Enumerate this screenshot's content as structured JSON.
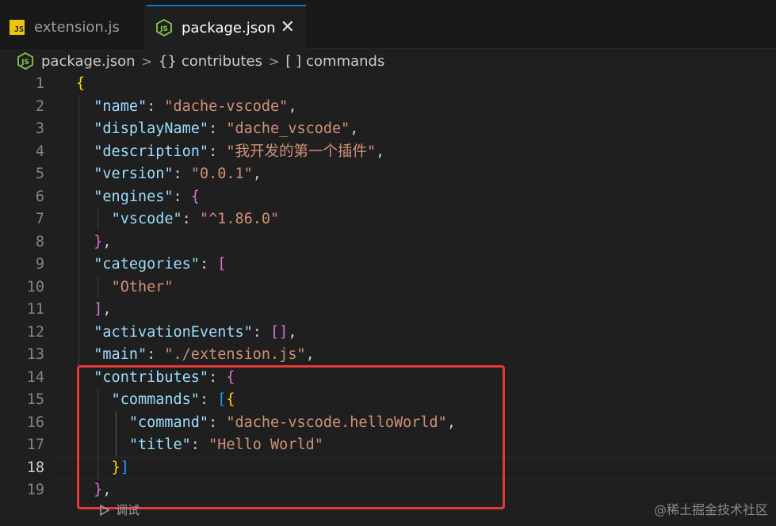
{
  "tabs": [
    {
      "label": "extension.js",
      "icon": "js-file-icon",
      "active": false
    },
    {
      "label": "package.json",
      "icon": "nodejs-file-icon",
      "active": true,
      "close": "✕"
    }
  ],
  "breadcrumb": {
    "file": "package.json",
    "sep": ">",
    "item1_sym": "{}",
    "item1": "contributes",
    "item2_sym": "[ ]",
    "item2": "commands"
  },
  "lines": [
    {
      "n": "1",
      "parts": [
        [
          "b1",
          "{"
        ]
      ]
    },
    {
      "n": "2",
      "parts": [
        [
          "p",
          "  "
        ],
        [
          "k",
          "\"name\""
        ],
        [
          "p",
          ": "
        ],
        [
          "s",
          "\"dache-vscode\""
        ],
        [
          "p",
          ","
        ]
      ]
    },
    {
      "n": "3",
      "parts": [
        [
          "p",
          "  "
        ],
        [
          "k",
          "\"displayName\""
        ],
        [
          "p",
          ": "
        ],
        [
          "s",
          "\"dache_vscode\""
        ],
        [
          "p",
          ","
        ]
      ]
    },
    {
      "n": "4",
      "parts": [
        [
          "p",
          "  "
        ],
        [
          "k",
          "\"description\""
        ],
        [
          "p",
          ": "
        ],
        [
          "s",
          "\"我开发的第一个插件\""
        ],
        [
          "p",
          ","
        ]
      ]
    },
    {
      "n": "5",
      "parts": [
        [
          "p",
          "  "
        ],
        [
          "k",
          "\"version\""
        ],
        [
          "p",
          ": "
        ],
        [
          "s",
          "\"0.0.1\""
        ],
        [
          "p",
          ","
        ]
      ]
    },
    {
      "n": "6",
      "parts": [
        [
          "p",
          "  "
        ],
        [
          "k",
          "\"engines\""
        ],
        [
          "p",
          ": "
        ],
        [
          "b2",
          "{"
        ]
      ]
    },
    {
      "n": "7",
      "parts": [
        [
          "p",
          "    "
        ],
        [
          "k",
          "\"vscode\""
        ],
        [
          "p",
          ": "
        ],
        [
          "s",
          "\"^1.86.0\""
        ]
      ]
    },
    {
      "n": "8",
      "parts": [
        [
          "p",
          "  "
        ],
        [
          "b2",
          "}"
        ],
        [
          "p",
          ","
        ]
      ]
    },
    {
      "n": "9",
      "parts": [
        [
          "p",
          "  "
        ],
        [
          "k",
          "\"categories\""
        ],
        [
          "p",
          ": "
        ],
        [
          "b2",
          "["
        ]
      ]
    },
    {
      "n": "10",
      "parts": [
        [
          "p",
          "    "
        ],
        [
          "s",
          "\"Other\""
        ]
      ]
    },
    {
      "n": "11",
      "parts": [
        [
          "p",
          "  "
        ],
        [
          "b2",
          "]"
        ],
        [
          "p",
          ","
        ]
      ]
    },
    {
      "n": "12",
      "parts": [
        [
          "p",
          "  "
        ],
        [
          "k",
          "\"activationEvents\""
        ],
        [
          "p",
          ": "
        ],
        [
          "b2",
          "[]"
        ],
        [
          "p",
          ","
        ]
      ]
    },
    {
      "n": "13",
      "parts": [
        [
          "p",
          "  "
        ],
        [
          "k",
          "\"main\""
        ],
        [
          "p",
          ": "
        ],
        [
          "s",
          "\"./extension.js\""
        ],
        [
          "p",
          ","
        ]
      ]
    },
    {
      "n": "14",
      "parts": [
        [
          "p",
          "  "
        ],
        [
          "k",
          "\"contributes\""
        ],
        [
          "p",
          ": "
        ],
        [
          "b2",
          "{"
        ]
      ]
    },
    {
      "n": "15",
      "parts": [
        [
          "p",
          "    "
        ],
        [
          "k",
          "\"commands\""
        ],
        [
          "p",
          ": "
        ],
        [
          "b3",
          "["
        ],
        [
          "b1",
          "{"
        ]
      ]
    },
    {
      "n": "16",
      "parts": [
        [
          "p",
          "      "
        ],
        [
          "k",
          "\"command\""
        ],
        [
          "p",
          ": "
        ],
        [
          "s",
          "\"dache-vscode.helloWorld\""
        ],
        [
          "p",
          ","
        ]
      ]
    },
    {
      "n": "17",
      "parts": [
        [
          "p",
          "      "
        ],
        [
          "k",
          "\"title\""
        ],
        [
          "p",
          ": "
        ],
        [
          "s",
          "\"Hello World\""
        ]
      ]
    },
    {
      "n": "18",
      "parts": [
        [
          "p",
          "    "
        ],
        [
          "b1",
          "}"
        ],
        [
          "b3",
          "]"
        ]
      ],
      "current": true
    },
    {
      "n": "19",
      "parts": [
        [
          "p",
          "  "
        ],
        [
          "b2",
          "}"
        ],
        [
          "p",
          ","
        ]
      ]
    }
  ],
  "codelens": "调试",
  "watermark": "@稀土掘金技术社区",
  "colors": {
    "highlight_box": "#e53935",
    "accent": "#0078d4"
  }
}
